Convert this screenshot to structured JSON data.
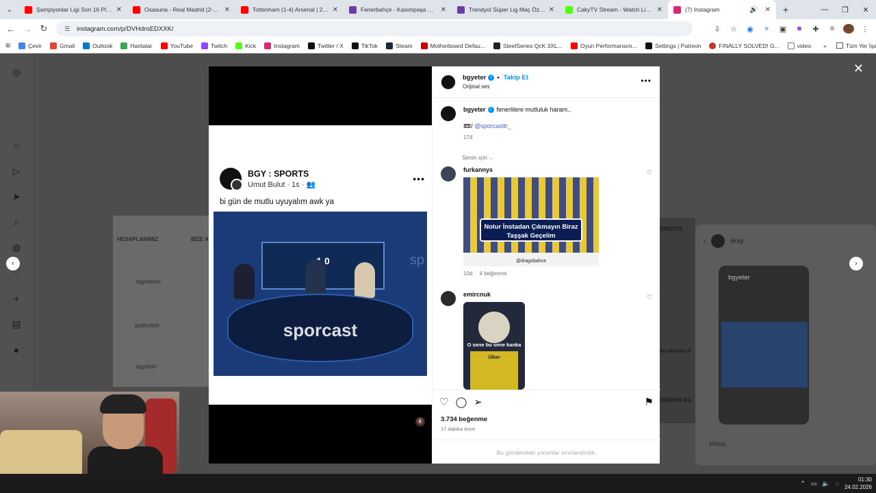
{
  "browser": {
    "tabs": [
      {
        "title": "Şampiyonlar Ligi Son 16 Play-Of",
        "color": "#ff0000"
      },
      {
        "title": "Osasuna - Real Madrid (2-1) - M",
        "color": "#ff0000"
      },
      {
        "title": "Tottenham (1-4) Arsenal | 27. H",
        "color": "#ff0000"
      },
      {
        "title": "Fenerbahçe - Kasımpaşa Maç Ö",
        "color": "#6b3fa0"
      },
      {
        "title": "Trendyol Süper Lig Maç Özetle",
        "color": "#6b3fa0"
      },
      {
        "title": "CakyTV Stream - Watch Live on",
        "color": "#53fc18"
      },
      {
        "title": "(7) Instagram",
        "color": "#d62976"
      }
    ],
    "url": "instagram.com/p/DVHdroEDXXK/",
    "bookmarks": [
      {
        "label": "Çevir",
        "color": "#4285f4"
      },
      {
        "label": "Gmail",
        "color": "#ea4335"
      },
      {
        "label": "Outlook",
        "color": "#0078d4"
      },
      {
        "label": "Haritalar",
        "color": "#34a853"
      },
      {
        "label": "YouTube",
        "color": "#ff0000"
      },
      {
        "label": "Twitch",
        "color": "#9146ff"
      },
      {
        "label": "Kick",
        "color": "#53fc18"
      },
      {
        "label": "Instagram",
        "color": "#d62976"
      },
      {
        "label": "Twitter / X",
        "color": "#111111"
      },
      {
        "label": "TikTok",
        "color": "#111111"
      },
      {
        "label": "Steam",
        "color": "#1b2838"
      },
      {
        "label": "Motherboard Defau...",
        "color": "#cc0000"
      },
      {
        "label": "SteelSeries QcK 3XL...",
        "color": "#222222"
      },
      {
        "label": "Oyun Performansını...",
        "color": "#ff0000"
      },
      {
        "label": "Settings | Patreon",
        "color": "#111111"
      },
      {
        "label": "FINALLY SOLVED! G...",
        "color": "#c0392b"
      },
      {
        "label": "video",
        "color": "#777777"
      }
    ],
    "all_bookmarks": "Tüm Yer İşaretleri"
  },
  "background": {
    "left_card": {
      "label1": "HESAPLARIMIZ",
      "label2": "BİZE A",
      "label3": "bgystanks",
      "label4": "godturtletr",
      "label5": "bgydizitr"
    },
    "dm": {
      "name": "éray",
      "mini_user": "bgyeter",
      "placeholder": "Mesaj..."
    },
    "mid": {
      "t1": "SPORTS",
      "t2": "en tersine d",
      "t3": "DİRENİŞ AG"
    }
  },
  "post": {
    "fb": {
      "page_name": "BGY : SPORTS",
      "author": "Umut Bulut · 1s · 👥",
      "text": "bi gün de mutlu uyuyalım awk ya",
      "screen_score": "1     0",
      "desk_logo": "sporcast",
      "stage_text": "sp"
    },
    "header": {
      "username": "bgyeter",
      "follow": "Takip Et",
      "audio": "Orijinal ses"
    },
    "caption": {
      "username": "bgyeter",
      "text": "fenerlilere mutluluk haram..",
      "mention_prefix": "📼/",
      "mention": "@sporcasttr_",
      "age": "17d",
      "sort": "Senin için ⌵"
    },
    "comments": [
      {
        "username": "furkannys",
        "meme_banner": "Nolur İnstadan Çıkmayın Biraz Taşşak Geçelim",
        "meme_caption": "@dragobahce",
        "age": "10d",
        "likes": "4 beğenme"
      },
      {
        "username": "emircnuk",
        "meme_top": "O sene bu sene kanka",
        "meme_shirt": "Ülker"
      }
    ],
    "likes": "3.734 beğenme",
    "time": "17 dakika önce",
    "limited": "Bu gönderideki yorumlar sınırlandırıldı."
  },
  "taskbar": {
    "time": "01:30",
    "date": "24.02.2026"
  }
}
